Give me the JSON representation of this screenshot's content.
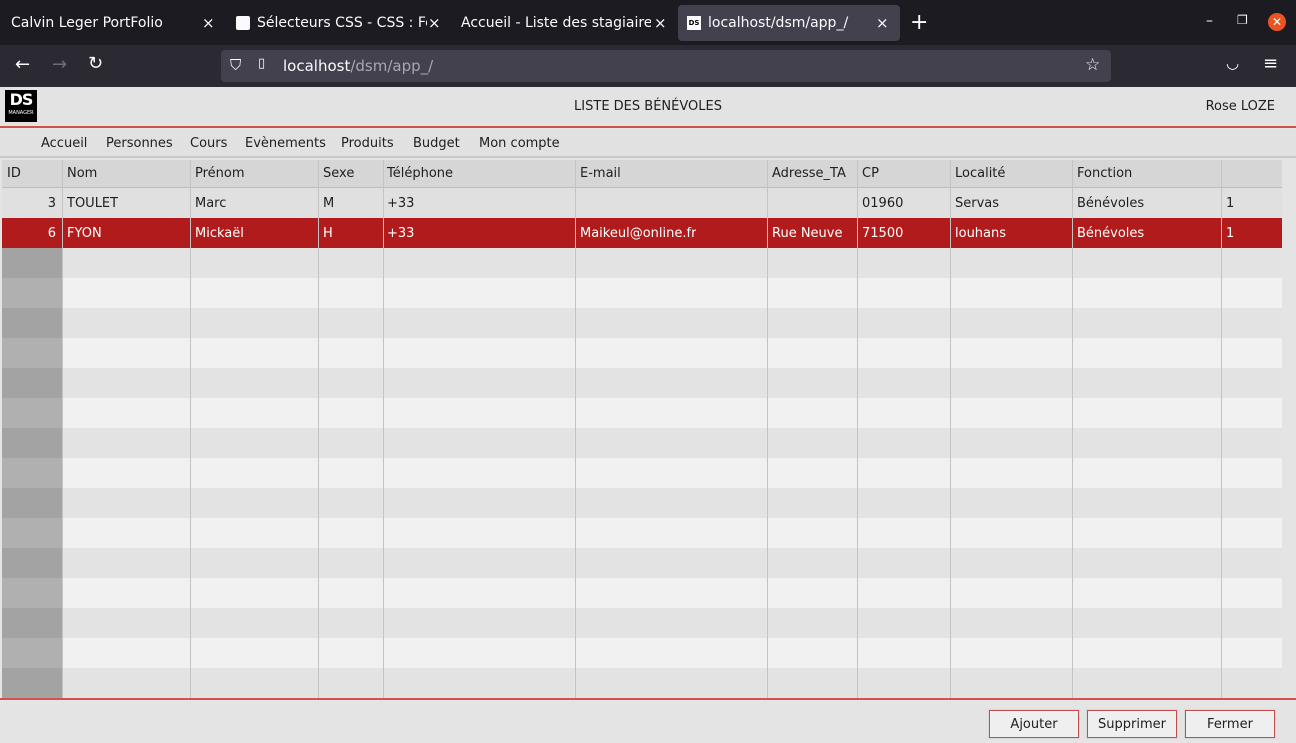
{
  "browser": {
    "tabs": [
      {
        "title": "Calvin Leger PortFolio",
        "active": false,
        "favicon": "none"
      },
      {
        "title": "Sélecteurs CSS - CSS : Feu",
        "active": false,
        "favicon": "mdn-dino-icon"
      },
      {
        "title": "Accueil - Liste des stagiaires",
        "active": false,
        "favicon": "none"
      },
      {
        "title": "localhost/dsm/app_/",
        "active": true,
        "favicon": "ds-favicon"
      }
    ],
    "close_glyph": "×",
    "new_tab_glyph": "+",
    "url_host": "localhost",
    "url_path": "/dsm/app_/"
  },
  "app": {
    "logo_big": "DS",
    "logo_small": "MANAGER",
    "page_title": "LISTE DES BÉNÉVOLES",
    "user_name": "Rose LOZE"
  },
  "menu": [
    "Accueil",
    "Personnes",
    "Cours",
    "Evènements",
    "Produits",
    "Budget",
    "Mon compte"
  ],
  "table": {
    "columns": [
      "ID",
      "Nom",
      "Prénom",
      "Sexe",
      "Téléphone",
      "E-mail",
      "Adresse_TA",
      "CP",
      "Localité",
      "Fonction",
      ""
    ],
    "rows": [
      {
        "id": "3",
        "nom": "TOULET",
        "prenom": "Marc",
        "sexe": "M",
        "telephone": "+33",
        "email": "",
        "adresse": "",
        "cp": "01960",
        "localite": "Servas",
        "fonction": "Bénévoles",
        "extra": "1",
        "selected": false
      },
      {
        "id": "6",
        "nom": "FYON",
        "prenom": "Mickaël",
        "sexe": "H",
        "telephone": "+33",
        "email": "Maikeul@online.fr",
        "adresse": "Rue Neuve",
        "cp": "71500",
        "localite": "louhans",
        "fonction": "Bénévoles",
        "extra": "1",
        "selected": true
      }
    ]
  },
  "footer": {
    "add_label": "Ajouter",
    "delete_label": "Supprimer",
    "close_label": "Fermer"
  },
  "colors": {
    "accent": "#b21b1b",
    "header_border": "#d64f4f"
  }
}
